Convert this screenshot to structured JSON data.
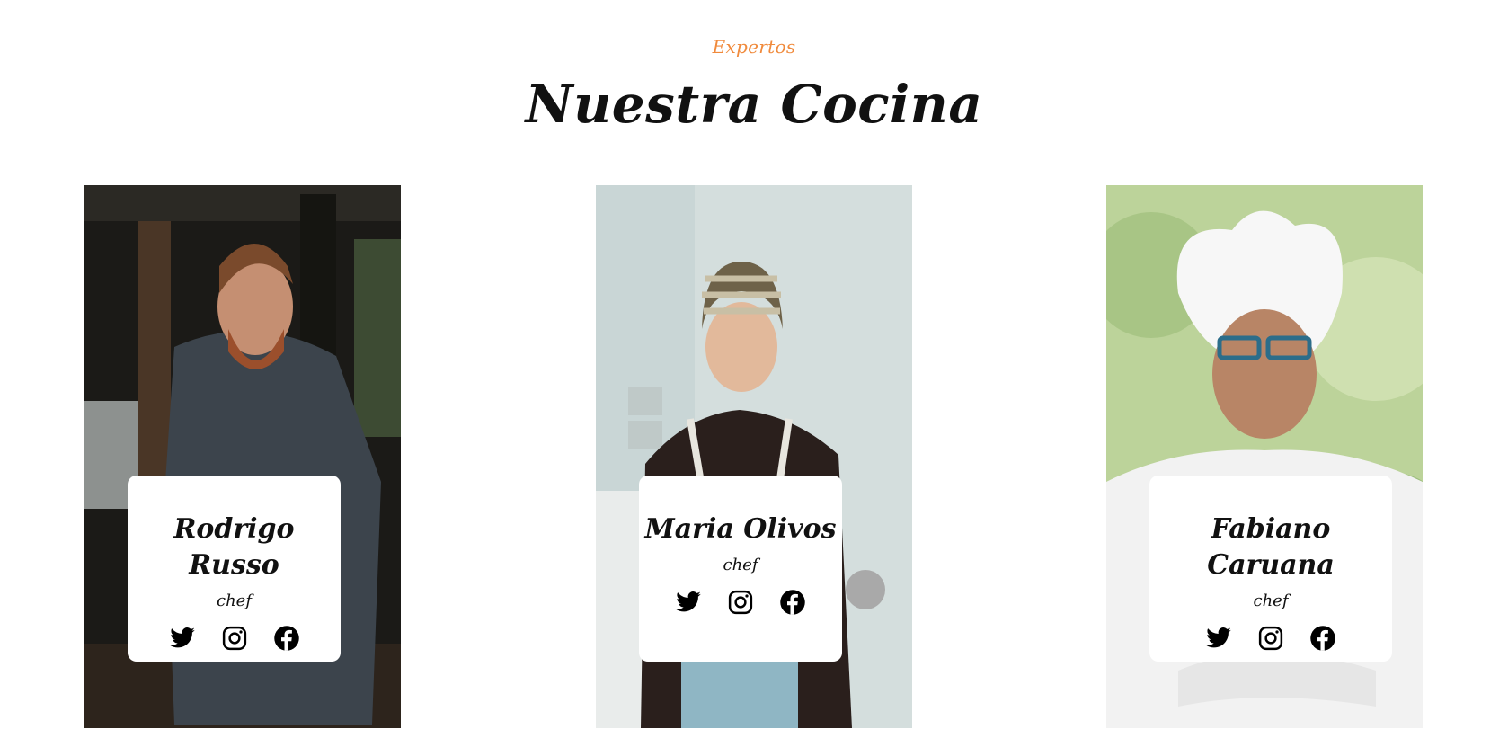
{
  "section": {
    "eyebrow": "Expertos",
    "title": "Nuestra Cocina"
  },
  "chefs": [
    {
      "name": "Rodrigo Russo",
      "role": "chef",
      "socials": [
        "twitter-icon",
        "instagram-icon",
        "facebook-icon"
      ]
    },
    {
      "name": "Maria Olivos",
      "role": "chef",
      "socials": [
        "twitter-icon",
        "instagram-icon",
        "facebook-icon"
      ]
    },
    {
      "name": "Fabiano Caruana",
      "role": "chef",
      "socials": [
        "twitter-icon",
        "instagram-icon",
        "facebook-icon"
      ]
    }
  ],
  "colors": {
    "accent": "#f08a3c",
    "text": "#111111",
    "background": "#ffffff"
  }
}
